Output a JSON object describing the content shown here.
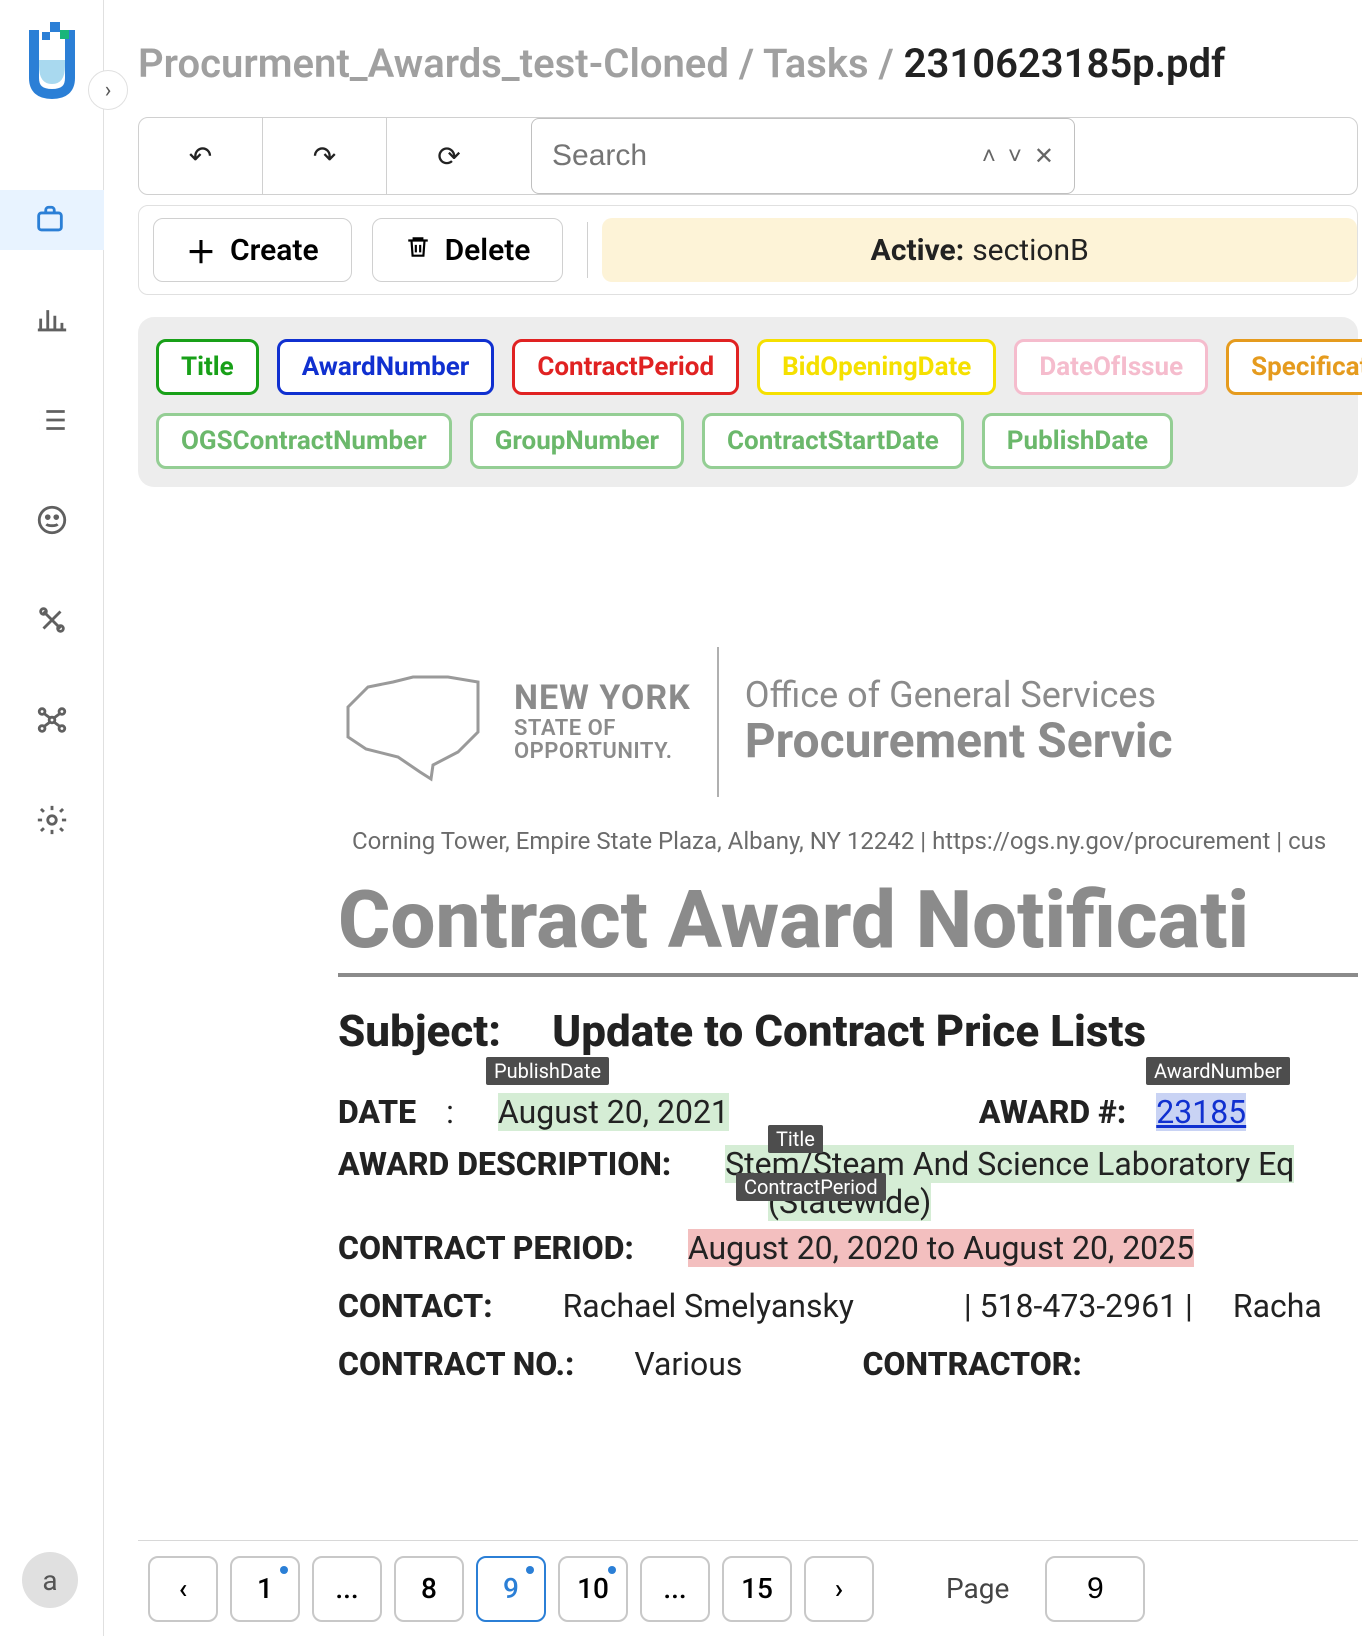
{
  "breadcrumb": {
    "part1": "Procurment_Awards_test-Cloned",
    "part2": "Tasks",
    "current": "2310623185p.pdf"
  },
  "toolbar": {
    "search_placeholder": "Search",
    "create_label": "Create",
    "delete_label": "Delete",
    "active_label": "Active:",
    "active_value": "sectionB"
  },
  "tags": {
    "row1": [
      "Title",
      "AwardNumber",
      "ContractPeriod",
      "BidOpeningDate",
      "DateOfIssue",
      "SpecificationR"
    ],
    "row2": [
      "OGSContractNumber",
      "GroupNumber",
      "ContractStartDate",
      "PublishDate"
    ]
  },
  "document": {
    "ny_state": "NEW YORK",
    "ny_sub1": "STATE OF",
    "ny_sub2": "OPPORTUNITY.",
    "ogs_l1": "Office of General Services",
    "ogs_l2": "Procurement Servic",
    "address": "Corning Tower, Empire State Plaza, Albany, NY 12242 | https://ogs.ny.gov/procurement | cus",
    "title": "Contract Award Notificati",
    "subject_label": "Subject:",
    "subject_text": "Update to Contract Price Lists",
    "date_label": "DATE",
    "date_colon": ":",
    "date_value": "August 20, 2021",
    "award_num_label": "AWARD #:",
    "award_num_value": "23185",
    "award_desc_label": "AWARD DESCRIPTION:",
    "award_desc_value": "Stem/Steam And Science Laboratory Eq",
    "award_desc_value2": "(Statewide)",
    "contract_period_label": "CONTRACT PERIOD:",
    "contract_period_value": "August 20, 2020 to August 20, 2025",
    "contact_label": "CONTACT:",
    "contact_name": "Rachael Smelyansky",
    "contact_phone": "| 518-473-2961 |",
    "contact_email": "Racha",
    "contract_no_label": "CONTRACT NO.:",
    "contract_no_value": "Various",
    "contractor_label": "CONTRACTOR:",
    "anno_publish": "PublishDate",
    "anno_award": "AwardNumber",
    "anno_title": "Title",
    "anno_period": "ContractPeriod"
  },
  "pager": {
    "pages": [
      "1",
      "...",
      "8",
      "9",
      "10",
      "...",
      "15"
    ],
    "page_label": "Page",
    "page_value": "9"
  },
  "user": {
    "initial": "a"
  }
}
